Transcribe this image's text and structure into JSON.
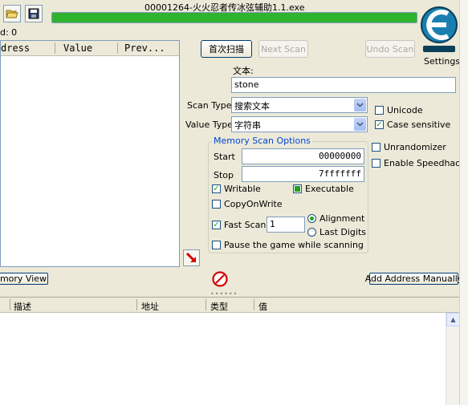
{
  "window": {
    "title": "00001264-火火忍者传冰弦辅助1.1.exe"
  },
  "progress": {
    "fraction": 1.0,
    "color": "#2fb32f"
  },
  "toolbar": {
    "open_icon": "open-folder-icon",
    "save_icon": "save-disk-icon"
  },
  "found_label": "d: 0",
  "settings_label": "Settings",
  "results_list": {
    "columns": [
      "dress",
      "Value",
      "Prev..."
    ]
  },
  "buttons": {
    "first_scan": "首次扫描",
    "next_scan": "Next Scan",
    "undo_scan": "Undo Scan",
    "memory_view": "mory View",
    "add_address": "Add Address Manually"
  },
  "scan": {
    "text_label": "文本:",
    "value": "stone",
    "scan_type_label": "Scan Type",
    "scan_type_value": "搜索文本",
    "value_type_label": "Value Type",
    "value_type_value": "字符串"
  },
  "options": {
    "unicode": "Unicode",
    "case_sensitive": "Case sensitive",
    "unrandomizer": "Unrandomizer",
    "enable_speedhack": "Enable Speedhack"
  },
  "memory_scan": {
    "title": "Memory Scan Options",
    "start_label": "Start",
    "start_value": "00000000",
    "stop_label": "Stop",
    "stop_value": "7fffffff",
    "writable": "Writable",
    "executable": "Executable",
    "copy_on_write": "CopyOnWrite",
    "fast_scan": "Fast Scan",
    "fast_scan_value": "1",
    "alignment": "Alignment",
    "last_digits": "Last Digits",
    "pause_game": "Pause the game while scanning"
  },
  "address_table": {
    "columns": [
      "描述",
      "地址",
      "类型",
      "值"
    ]
  },
  "colors": {
    "accent": "#0046d5",
    "check": "#21a121",
    "stop_red": "#d40000"
  }
}
